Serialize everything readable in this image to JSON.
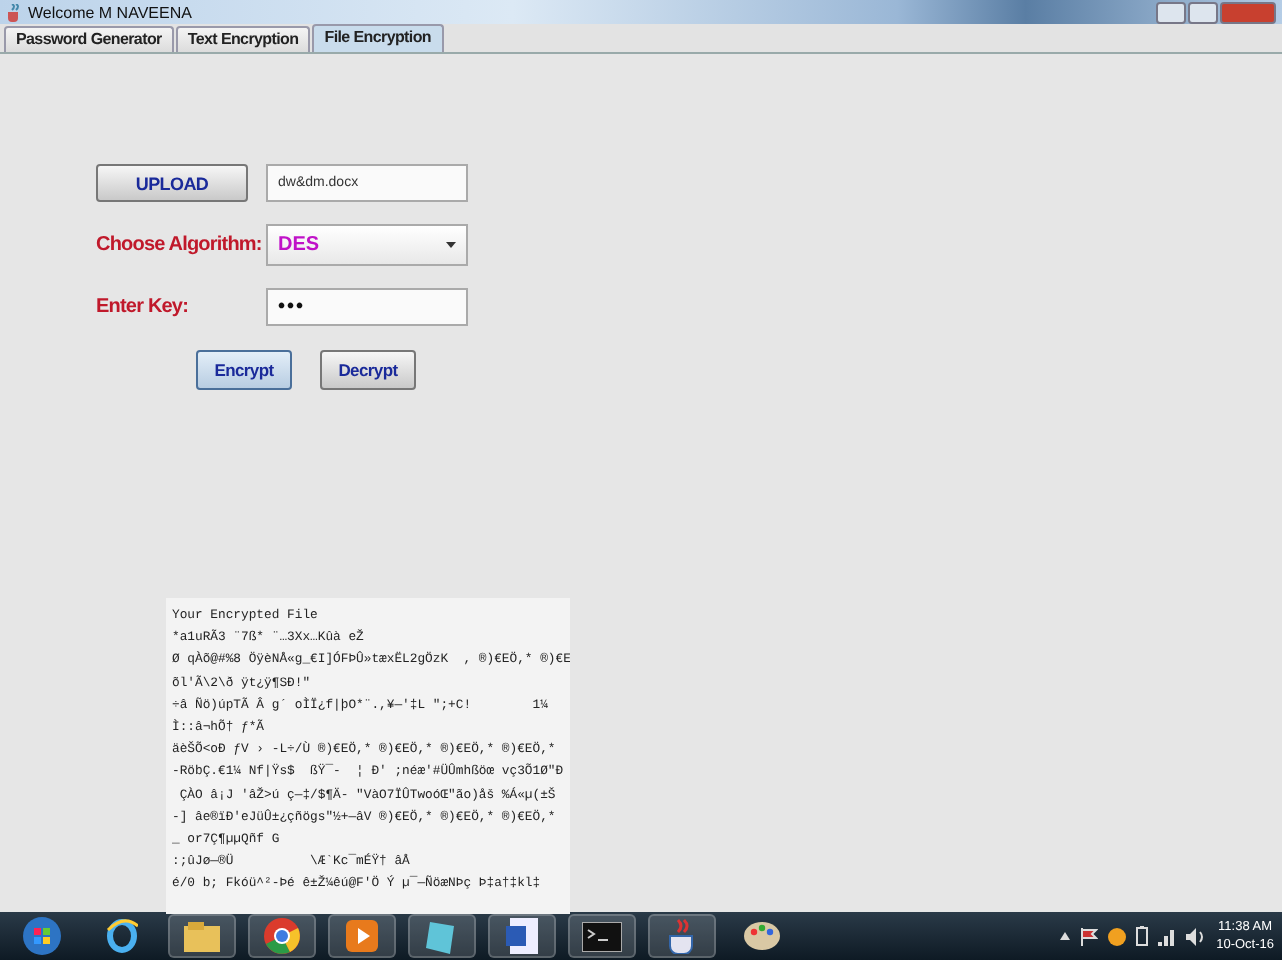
{
  "window": {
    "title": "Welcome  M NAVEENA"
  },
  "tabs": [
    {
      "label": "Password Generator",
      "selected": false
    },
    {
      "label": "Text Encryption",
      "selected": false
    },
    {
      "label": "File Encryption",
      "selected": true
    }
  ],
  "upload": {
    "button": "UPLOAD",
    "file": "dw&dm.docx"
  },
  "algorithm": {
    "label": "Choose Algorithm:",
    "value": "DES"
  },
  "key": {
    "label": "Enter Key:",
    "value": "•••"
  },
  "actions": [
    {
      "label": "Encrypt",
      "focused": true
    },
    {
      "label": "Decrypt",
      "focused": false
    }
  ],
  "output": {
    "lines": [
      "Your Encrypted File",
      "*a1uRÃ3 ¨7ß* ¨…3Xx…Kûà eŽ",
      "Ø qÀõ@#%8 ÖÿèNÅ«g_€I]ÓFÞÛ»tæxËL2gÖzK  , ®)€EÖ,* ®)€E",
      "õl'Ã\\2\\ð ÿt¿ÿ¶SÐ!\"",
      "÷â Ñö)úpTÃ Â g´ oÌÏ¿f|þO*¨.,¥—'‡L \";+C!        1¼",
      "Ì::â¬hÕ† ƒ*Ã",
      "äèŠÕ<oÐ ƒV › -L÷/Ù ®)€EÖ,* ®)€EÖ,* ®)€EÖ,* ®)€EÖ,*",
      "-RöbÇ.€1¼ Nf|Ÿs$  ßŸ¯-  ¦ Ð' ;néæ'#ÜÛmhßöœ vç3Õ1Ø\"Ð",
      " ÇÀO â¡J 'âŽ>ú ç—‡/$¶Ä- \"VàO7ÏÛTwoóŒ\"ão)åš %Á«µ(±Š",
      "-] âe®ïÐ'eJüÛ±¿çñögs\"½+—âV ®)€EÖ,* ®)€EÖ,* ®)€EÖ,*",
      "_ or7Ç¶µµQñf G",
      ":;ûJø—®Ü          \\Æ`Kc¯mÉŸ† âÅ",
      "é/0 b; Fkóü^²-Þé ê±Ž¼êú@F'Ö Ý µ¯—ÑöæNÞç Þ‡a†‡kl‡"
    ]
  },
  "taskbar": {
    "time": "11:38 AM",
    "date": "10-Oct-16"
  }
}
